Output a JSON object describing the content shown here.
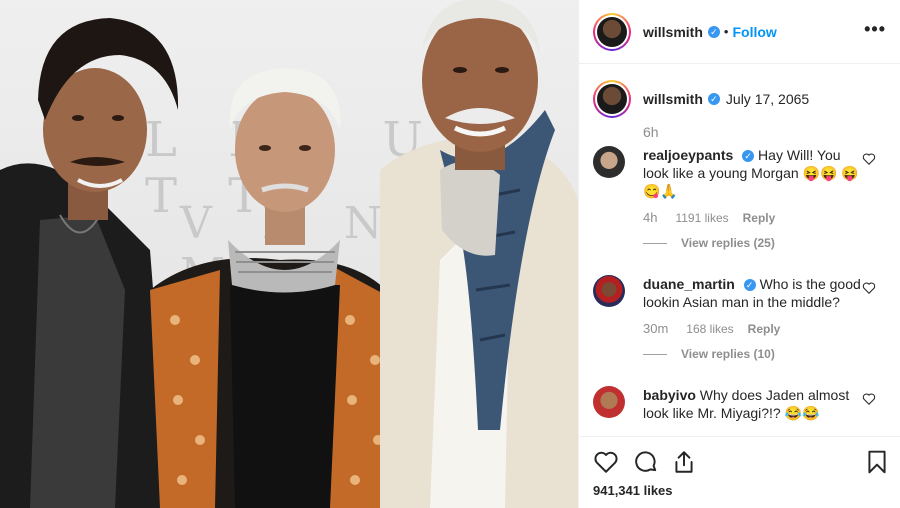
{
  "post": {
    "username": "willsmith",
    "follow_label": "Follow",
    "separator": "•",
    "more_label": "•••"
  },
  "caption": {
    "username": "willsmith",
    "date": "July 17, 2065",
    "ago": "6h"
  },
  "comments": [
    {
      "username": "realjoeypants",
      "verified": true,
      "text": "Hay Will! You look like a young Morgan 😝😝 😝😋🙏",
      "time": "4h",
      "likes": "1191 likes",
      "reply": "Reply",
      "view_replies": "View replies (25)"
    },
    {
      "username": "duane_martin",
      "verified": true,
      "text": "Who is the good lookin Asian man in the middle?",
      "time": "30m",
      "likes": "168 likes",
      "reply": "Reply",
      "view_replies": "View replies (10)"
    },
    {
      "username": "babyivo",
      "verified": false,
      "text": "Why does Jaden almost look like Mr. Miyagi?!? 😂😂"
    }
  ],
  "footer": {
    "likes_count": "941,341 likes"
  },
  "photo": {
    "wall_text_top": "L I S  U I T T",
    "wall_text_bottom": "V E N D Ô M"
  },
  "icons": {
    "verified": "verified-badge-icon",
    "heart": "heart-outline-icon",
    "comment": "speech-bubble-icon",
    "share": "share-arrow-icon",
    "save": "bookmark-icon",
    "more": "ellipsis-icon"
  },
  "colors": {
    "link_blue": "#0095f6",
    "verified_blue": "#3897f0",
    "muted_text": "#8e8e8e",
    "primary_text": "#262626"
  }
}
